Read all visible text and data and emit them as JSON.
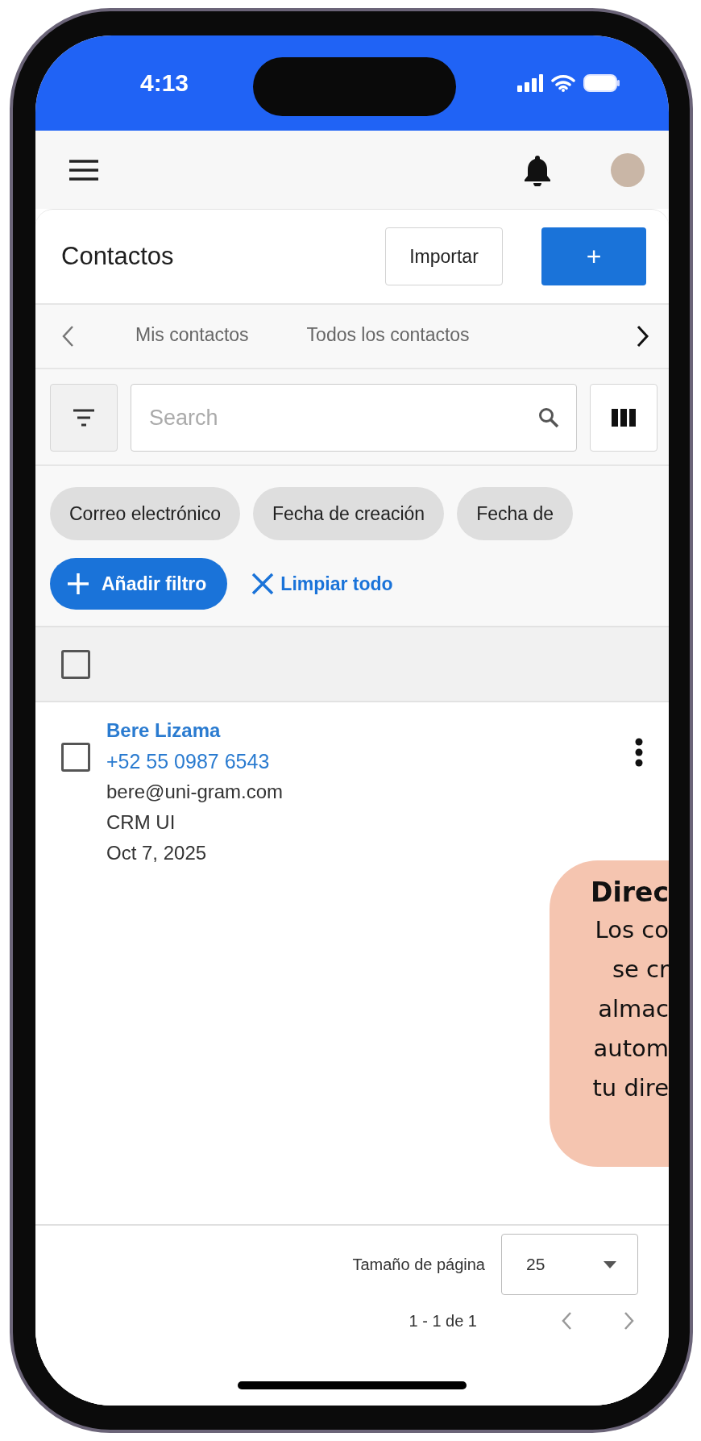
{
  "status_bar": {
    "time": "4:13"
  },
  "header": {
    "title": "Contactos",
    "buttons": [
      {
        "label": "Importar",
        "kind": "outline"
      },
      {
        "label": "+",
        "kind": "primary"
      }
    ]
  },
  "tabs": [
    {
      "label": "Mis contactos",
      "selected": false
    },
    {
      "label": "Todos los contactos",
      "selected": false
    }
  ],
  "search": {
    "placeholder": "Search"
  },
  "filter_chips": [
    "Correo electrónico",
    "Fecha de creación",
    "Fecha de"
  ],
  "add_filter": "Añadir filtro",
  "clear_all": "Limpiar todo",
  "table": {
    "select_all": {
      "checked": false
    },
    "rows": [
      {
        "name": "Bere Lizama",
        "phone": "+52 55 0987 6543",
        "email": "bere@uni-gram.com",
        "company": "CRM UI",
        "date": "Oct 7, 2025",
        "checked": false
      }
    ]
  },
  "callout": {
    "title": "Direc",
    "lines": [
      "Los co",
      "se cr",
      "almac",
      "autom",
      "tu dire"
    ]
  },
  "pagination": {
    "page_size_label": "Tamaño de página",
    "page_size": "25",
    "range": "1 - 1 de 1"
  }
}
